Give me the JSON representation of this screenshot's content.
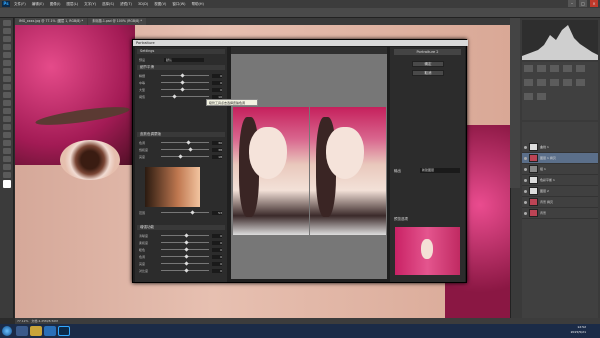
{
  "menubar": {
    "logo": "Ps",
    "items": [
      "文件(F)",
      "编辑(E)",
      "图像(I)",
      "图层(L)",
      "文字(Y)",
      "选择(S)",
      "滤镜(T)",
      "3D(D)",
      "视图(V)",
      "窗口(W)",
      "帮助(H)"
    ]
  },
  "tabs": [
    "IMG_xxxx.jpg @ 77.1% (图层 1, RGB/8) *",
    "未标题-1.psd @ 100% (RGB/8) *"
  ],
  "dialog": {
    "title": "Portraiture",
    "settings_label": "Settings",
    "preset_label": "预设",
    "preset_value": "默认",
    "sections": {
      "detail_smoothing": "细节平滑",
      "skin_tone_mask": "皮肤色调蒙版",
      "enhancements": "增强功能"
    },
    "detail_rows": [
      {
        "label": "精细",
        "value": "0"
      },
      {
        "label": "中等",
        "value": "0"
      },
      {
        "label": "大型",
        "value": "0"
      },
      {
        "label": "阈值",
        "value": "10"
      }
    ],
    "skin_rows": [
      {
        "label": "色调",
        "value": "30"
      },
      {
        "label": "饱和度",
        "value": "38"
      },
      {
        "label": "亮度",
        "value": "18"
      },
      {
        "label": "范围",
        "value": "53"
      }
    ],
    "enhance_rows": [
      {
        "label": "清晰度",
        "value": "0"
      },
      {
        "label": "柔和度",
        "value": "0"
      },
      {
        "label": "暖色",
        "value": "0"
      },
      {
        "label": "色调",
        "value": "0"
      },
      {
        "label": "亮度",
        "value": "0"
      },
      {
        "label": "对比度",
        "value": "0"
      }
    ],
    "right": {
      "logo": "Portraiture 2",
      "ok": "确定",
      "cancel": "取消",
      "output_label": "输出",
      "output_value": "新建图层",
      "preview_label": "预览选项"
    },
    "tooltip": "吸管工具点击选择皮肤色调"
  },
  "layers": [
    {
      "name": "曲线 1"
    },
    {
      "name": "图层 1 拷贝"
    },
    {
      "name": "组 1"
    },
    {
      "name": "色彩平衡 1"
    },
    {
      "name": "图层 2"
    },
    {
      "name": "背景 拷贝"
    },
    {
      "name": "背景"
    }
  ],
  "status": {
    "zoom": "77.12%",
    "doc": "文档:4.25M/8.50M"
  },
  "clock": {
    "time": "12:52",
    "date": "2015/5/21"
  }
}
